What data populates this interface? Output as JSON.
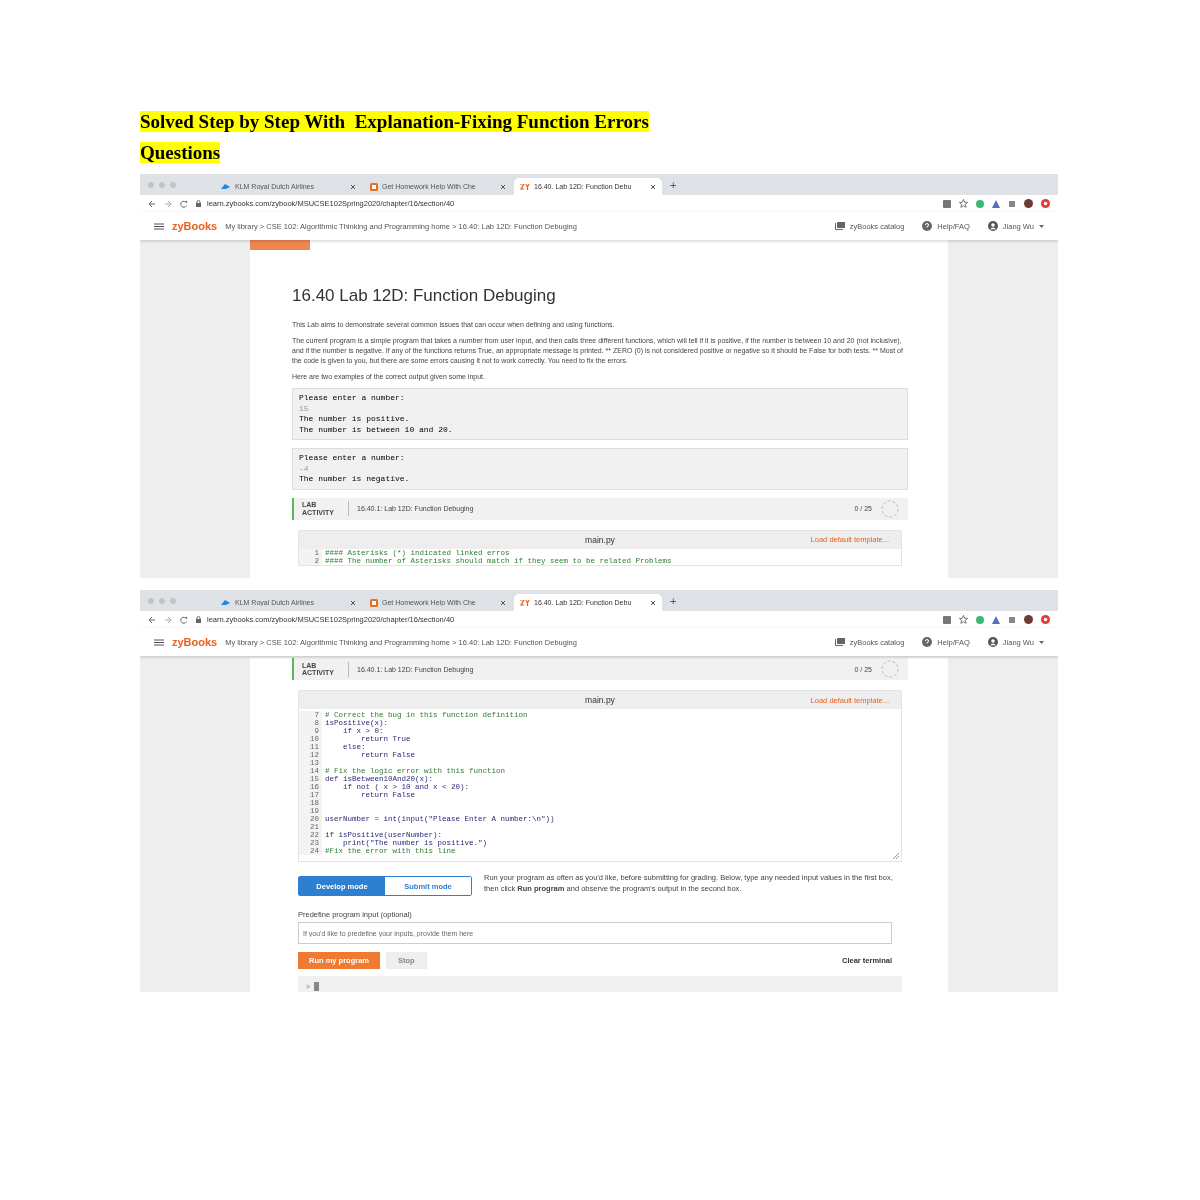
{
  "document_title": {
    "lines": [
      "Solved Step by Step With  Explanation-Fixing Function Errors",
      "Questions"
    ]
  },
  "screenshots": [
    {
      "browser": {
        "tabs": [
          {
            "title": "KLM Royal Dutch Airlines",
            "kind": "klm",
            "selected": false
          },
          {
            "title": "Get Homework Help With Che",
            "kind": "chegg",
            "selected": false
          },
          {
            "title": "16.40. Lab 12D: Function Debu",
            "kind": "zy",
            "selected": true
          }
        ],
        "new_tab": "+",
        "url": "learn.zybooks.com/zybook/MSUCSE102Spring2020/chapter/16/section/40"
      },
      "header": {
        "logo": "zyBooks",
        "breadcrumb": "My library > CSE 102: Algorithmic Thinking and Programming home > 16.40: Lab 12D: Function Debuging",
        "catalog": "zyBooks catalog",
        "help": "Help/FAQ",
        "user": "Jiang Wu"
      },
      "lesson": {
        "title": "16.40 Lab 12D: Function Debuging",
        "paragraphs": [
          "This Lab aims to demonstrate several common issues that can occur when defining and using functions.",
          "The current program is a simple program that takes a number from user input, and then calls three different functions, which will tell if it is positive, if the number is between 10 and 20 (not inclusive), and if the number is negative. If any of the functions returns True, an appropriate message is printed. ** ZERO (0) is not considered positive or negative so it should be False for both tests. ** Most of the code is given to you, but there are some errors causing it not to work correctly. You need to fix the errors.",
          "Here are two examples of the correct output given some input."
        ],
        "examples": [
          {
            "lines": [
              {
                "text": "Please enter a number:",
                "kind": "output"
              },
              {
                "text": "15",
                "kind": "input"
              },
              {
                "text": "The number is positive.",
                "kind": "output"
              },
              {
                "text": "The number is between 10 and 20.",
                "kind": "output"
              }
            ]
          },
          {
            "lines": [
              {
                "text": "Please enter a number:",
                "kind": "output"
              },
              {
                "text": "-4",
                "kind": "input"
              },
              {
                "text": "The number is negative.",
                "kind": "output"
              }
            ]
          }
        ]
      },
      "lab_activity": {
        "label": "LAB ACTIVITY",
        "title": "16.40.1: Lab 12D: Function Debuging",
        "score": "0 / 25"
      },
      "editor": {
        "filename": "main.py",
        "template_link": "Load default template...",
        "lines": [
          {
            "number": "1",
            "text": "#### Asterisks (*) indicated linked erros",
            "kind": "comment"
          },
          {
            "number": "2",
            "text": "#### The number of Asterisks should match if they seem to be related Problems",
            "kind": "comment"
          }
        ]
      }
    },
    {
      "browser": {
        "tabs": [
          {
            "title": "KLM Royal Dutch Airlines",
            "kind": "klm",
            "selected": false
          },
          {
            "title": "Get Homework Help With Che",
            "kind": "chegg",
            "selected": false
          },
          {
            "title": "16.40. Lab 12D: Function Debu",
            "kind": "zy",
            "selected": true
          }
        ],
        "new_tab": "+",
        "url": "learn.zybooks.com/zybook/MSUCSE102Spring2020/chapter/16/section/40"
      },
      "header": {
        "logo": "zyBooks",
        "breadcrumb": "My library > CSE 102: Algorithmic Thinking and Programming home > 16.40: Lab 12D: Function Debuging",
        "catalog": "zyBooks catalog",
        "help": "Help/FAQ",
        "user": "Jiang Wu"
      },
      "lab_activity": {
        "label": "LAB ACTIVITY",
        "title": "16.40.1: Lab 12D: Function Debuging",
        "score": "0 / 25"
      },
      "editor": {
        "filename": "main.py",
        "template_link": "Load default template...",
        "lines": [
          {
            "number": "7",
            "text": "# Correct the bug in this function definition",
            "kind": "comment"
          },
          {
            "number": "8",
            "text": "isPositive(x):",
            "kind": "code"
          },
          {
            "number": "9",
            "text": "    if x > 0:",
            "kind": "code"
          },
          {
            "number": "10",
            "text": "        return True",
            "kind": "code"
          },
          {
            "number": "11",
            "text": "    else:",
            "kind": "code"
          },
          {
            "number": "12",
            "text": "        return False",
            "kind": "code"
          },
          {
            "number": "13"
          },
          {
            "number": "14",
            "text": "# Fix the logic error with this function",
            "kind": "comment"
          },
          {
            "number": "15",
            "text": "def isBetween10And20(x):",
            "kind": "code"
          },
          {
            "number": "16",
            "text": "    if not ( x > 10 and x < 20):",
            "kind": "code"
          },
          {
            "number": "17",
            "text": "        return False",
            "kind": "code"
          },
          {
            "number": "18"
          },
          {
            "number": "19"
          },
          {
            "number": "20",
            "text": "userNumber = int(input(\"Please Enter A number:\\n\"))",
            "kind": "code"
          },
          {
            "number": "21"
          },
          {
            "number": "22",
            "text": "if isPositive(userNumber):",
            "kind": "code"
          },
          {
            "number": "23",
            "text": "    print(\"The number is positive.\")",
            "kind": "code"
          },
          {
            "number": "24",
            "text": "#Fix the error with this line",
            "kind": "comment"
          }
        ]
      },
      "runner": {
        "modes": [
          {
            "label": "Develop mode",
            "selected": true
          },
          {
            "label": "Submit mode",
            "selected": false
          }
        ],
        "description": "Run your program as often as you'd like, before submitting for grading. Below, type any needed input values in the first box, then click **Run program** and observe the program's output in the second box.",
        "input_label": "Predefine program input (optional)",
        "input_placeholder": "If you'd like to predefine your inputs, provide them here",
        "run_button": "Run my program",
        "stop_button": {
          "label": "Stop",
          "disabled": true
        },
        "clear_terminal": "Clear terminal",
        "prompt": ">"
      }
    }
  ]
}
